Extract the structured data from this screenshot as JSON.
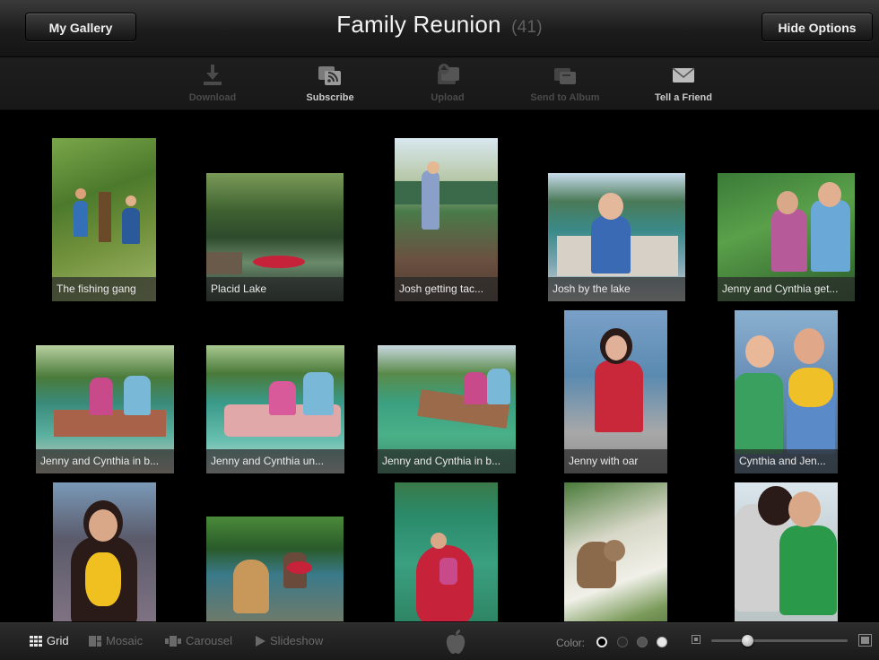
{
  "header": {
    "left_button": "My Gallery",
    "title": "Family Reunion",
    "count": "(41)",
    "right_button": "Hide Options"
  },
  "toolbar": {
    "items": [
      {
        "label": "Download",
        "icon": "download-icon",
        "enabled": false
      },
      {
        "label": "Subscribe",
        "icon": "rss-subscribe-icon",
        "enabled": true
      },
      {
        "label": "Upload",
        "icon": "upload-icon",
        "enabled": false
      },
      {
        "label": "Send to Album",
        "icon": "send-to-album-icon",
        "enabled": false
      },
      {
        "label": "Tell a Friend",
        "icon": "envelope-icon",
        "enabled": true
      }
    ]
  },
  "photos": [
    {
      "caption": "The fishing gang"
    },
    {
      "caption": "Placid Lake"
    },
    {
      "caption": "Josh getting tac..."
    },
    {
      "caption": "Josh by the lake"
    },
    {
      "caption": "Jenny and Cynthia get..."
    },
    {
      "caption": "Jenny and Cynthia in b..."
    },
    {
      "caption": "Jenny and Cynthia un..."
    },
    {
      "caption": "Jenny and Cynthia in b..."
    },
    {
      "caption": "Jenny with oar"
    },
    {
      "caption": "Cynthia and Jen..."
    },
    {
      "caption": ""
    },
    {
      "caption": ""
    },
    {
      "caption": ""
    },
    {
      "caption": ""
    },
    {
      "caption": ""
    }
  ],
  "bottom": {
    "views": [
      {
        "label": "Grid",
        "icon": "grid-icon",
        "active": true
      },
      {
        "label": "Mosaic",
        "icon": "mosaic-icon",
        "active": false
      },
      {
        "label": "Carousel",
        "icon": "carousel-icon",
        "active": false
      },
      {
        "label": "Slideshow",
        "icon": "play-icon",
        "active": false
      }
    ],
    "color_label": "Color:",
    "colors": [
      "#000000",
      "#2a2a2a",
      "#555555",
      "#e8e8e8"
    ],
    "selected_color": 0
  }
}
